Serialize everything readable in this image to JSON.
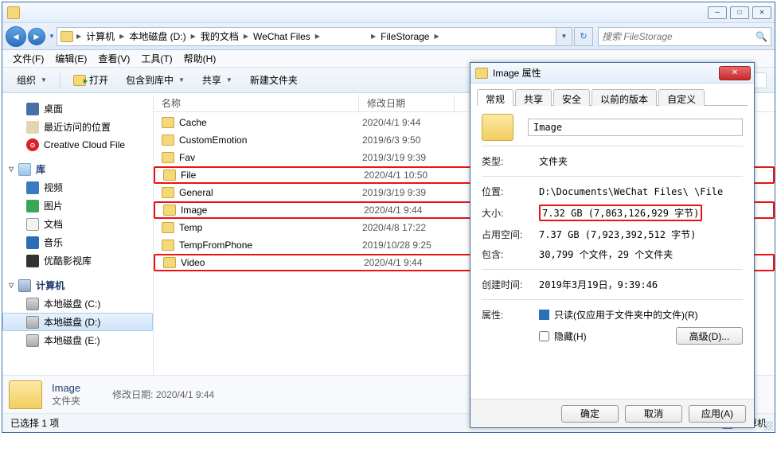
{
  "window": {
    "min": "—",
    "max": "☐",
    "close": "✕"
  },
  "breadcrumbs": [
    "计算机",
    "本地磁盘 (D:)",
    "我的文档",
    "WeChat Files",
    "",
    "FileStorage"
  ],
  "search": {
    "placeholder": "搜索 FileStorage"
  },
  "menubar": [
    "文件(F)",
    "编辑(E)",
    "查看(V)",
    "工具(T)",
    "帮助(H)"
  ],
  "toolbar": {
    "organize": "组织",
    "open": "打开",
    "include": "包含到库中",
    "share": "共享",
    "newfolder": "新建文件夹"
  },
  "nav": {
    "fav_items": [
      {
        "icon": "desk",
        "label": "桌面"
      },
      {
        "icon": "recent",
        "label": "最近访问的位置"
      },
      {
        "icon": "ccloud",
        "label": "Creative Cloud File"
      }
    ],
    "lib_hdr": "库",
    "lib_items": [
      {
        "icon": "vid",
        "label": "视频"
      },
      {
        "icon": "pic",
        "label": "图片"
      },
      {
        "icon": "doc",
        "label": "文档"
      },
      {
        "icon": "mus",
        "label": "音乐"
      },
      {
        "icon": "youku",
        "label": "优酷影视库"
      }
    ],
    "comp_hdr": "计算机",
    "comp_items": [
      {
        "icon": "disk",
        "label": "本地磁盘 (C:)",
        "sel": false
      },
      {
        "icon": "disk",
        "label": "本地磁盘 (D:)",
        "sel": true
      },
      {
        "icon": "disk",
        "label": "本地磁盘 (E:)",
        "sel": false
      }
    ]
  },
  "list": {
    "col_name": "名称",
    "col_date": "修改日期",
    "rows": [
      {
        "name": "Cache",
        "date": "2020/4/1 9:44",
        "hl": false
      },
      {
        "name": "CustomEmotion",
        "date": "2019/6/3 9:50",
        "hl": false
      },
      {
        "name": "Fav",
        "date": "2019/3/19 9:39",
        "hl": false
      },
      {
        "name": "File",
        "date": "2020/4/1 10:50",
        "hl": true
      },
      {
        "name": "General",
        "date": "2019/3/19 9:39",
        "hl": false
      },
      {
        "name": "Image",
        "date": "2020/4/1 9:44",
        "hl": true
      },
      {
        "name": "Temp",
        "date": "2020/4/8 17:22",
        "hl": false
      },
      {
        "name": "TempFromPhone",
        "date": "2019/10/28 9:25",
        "hl": false
      },
      {
        "name": "Video",
        "date": "2020/4/1 9:44",
        "hl": true
      }
    ]
  },
  "detail": {
    "title": "Image",
    "type": "文件夹",
    "modlabel": "修改日期:",
    "moddate": "2020/4/1 9:44"
  },
  "status": {
    "left": "已选择 1 项",
    "right": "计算机"
  },
  "dialog": {
    "title": "Image 属性",
    "tabs": [
      "常规",
      "共享",
      "安全",
      "以前的版本",
      "自定义"
    ],
    "name": "Image",
    "rows": {
      "type_l": "类型:",
      "type_v": "文件夹",
      "loc_l": "位置:",
      "loc_v": "D:\\Documents\\WeChat Files\\        \\File",
      "size_l": "大小:",
      "size_v": "7.32 GB (7,863,126,929 字节)",
      "ondisk_l": "占用空间:",
      "ondisk_v": "7.37 GB (7,923,392,512 字节)",
      "contains_l": "包含:",
      "contains_v": "30,799 个文件，29 个文件夹",
      "created_l": "创建时间:",
      "created_v": "2019年3月19日，9:39:46",
      "attr_l": "属性:",
      "ro": "只读(仅应用于文件夹中的文件)(R)",
      "hidden": "隐藏(H)",
      "adv": "高级(D)..."
    },
    "buttons": {
      "ok": "确定",
      "cancel": "取消",
      "apply": "应用(A)"
    }
  }
}
